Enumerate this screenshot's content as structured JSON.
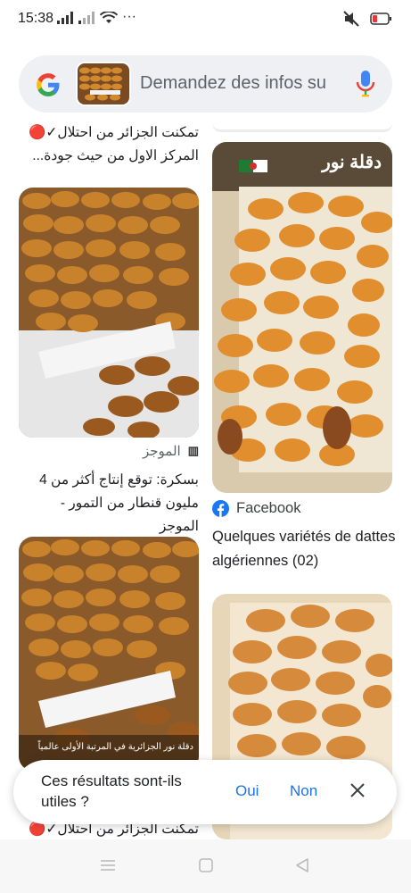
{
  "status_bar": {
    "time": "15:38",
    "dots": "···"
  },
  "search": {
    "placeholder": "Demandez des infos su",
    "icons": [
      "google-logo",
      "image-thumbnail",
      "mic-icon"
    ]
  },
  "results": {
    "left": [
      {
        "caption": "تمكنت الجزائر من احتلال✓🔴 المركز الاول من حيث جودة..."
      },
      {
        "source": "الموجز",
        "caption": "بسكرة: توقع إنتاج أكثر من 4 مليون قنطار من التمور - الموجز"
      },
      {
        "overlay": "دقلة نور الجزائرية في المرتبة الأولى عالمياً",
        "caption": "تمكنت الجزائر من احتلال✓🔴"
      }
    ],
    "right": [
      {
        "image_label": "دقلة نور",
        "source": "Facebook",
        "title": "Quelques variétés de dattes algériennes (02)"
      },
      {
        "image_label": ""
      }
    ]
  },
  "feedback": {
    "question": "Ces résultats sont-ils utiles ?",
    "yes": "Oui",
    "no": "Non"
  },
  "colors": {
    "accent": "#1a73e8",
    "search_bg": "#eef0f3",
    "text": "#202124",
    "muted": "#5f6368"
  }
}
